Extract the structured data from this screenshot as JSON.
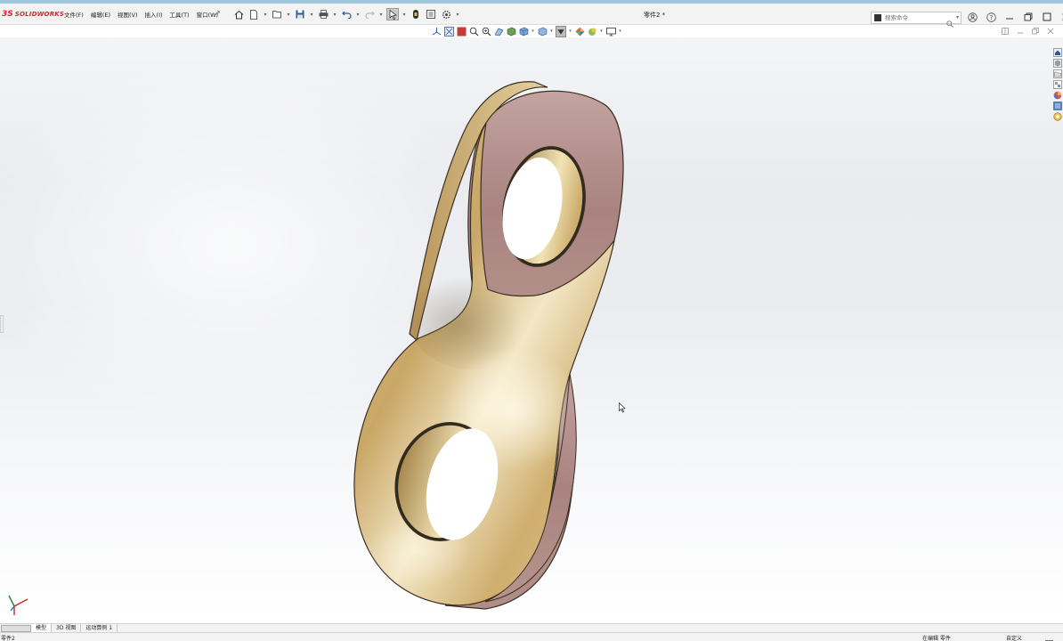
{
  "app": {
    "brand_prefix": "3S",
    "brand_name": "SOLIDWORKS",
    "document_title": "零件2 *"
  },
  "menu": [
    {
      "label": "文件(F)"
    },
    {
      "label": "编辑(E)"
    },
    {
      "label": "视图(V)"
    },
    {
      "label": "插入(I)"
    },
    {
      "label": "工具(T)"
    },
    {
      "label": "窗口(W)"
    }
  ],
  "quick_access_icons": [
    "home-icon",
    "new-document-icon",
    "open-icon",
    "save-icon",
    "print-icon",
    "undo-icon",
    "redo-icon",
    "select-icon",
    "rebuild-icon",
    "file-properties-icon",
    "options-icon"
  ],
  "search": {
    "placeholder": "搜索命令"
  },
  "view_toolbar_icons": [
    "view-triad-icon",
    "zoom-to-fit-icon",
    "zoom-area-icon",
    "previous-view-icon",
    "section-view-icon",
    "dynamic-annotation-icon",
    "view-orientation-icon",
    "display-style-icon",
    "hide-show-items-icon",
    "edit-appearance-icon",
    "apply-scene-icon",
    "view-settings-icon"
  ],
  "task_pane_icons": [
    "solidworks-resources-icon",
    "design-library-icon",
    "file-explorer-icon",
    "view-palette-icon",
    "appearances-icon",
    "custom-properties-icon",
    "3dexperience-icon"
  ],
  "bottom_tabs": [
    {
      "label": "模型",
      "active": true
    },
    {
      "label": "3D 视图",
      "active": false
    },
    {
      "label": "运动算例 1",
      "active": false
    }
  ],
  "status": {
    "document": "零件2",
    "mode": "在编辑 零件",
    "units": "自定义"
  },
  "colors": {
    "brand": "#d7262d",
    "part_gold": "#cfae6a",
    "part_rose": "#b18a86"
  }
}
